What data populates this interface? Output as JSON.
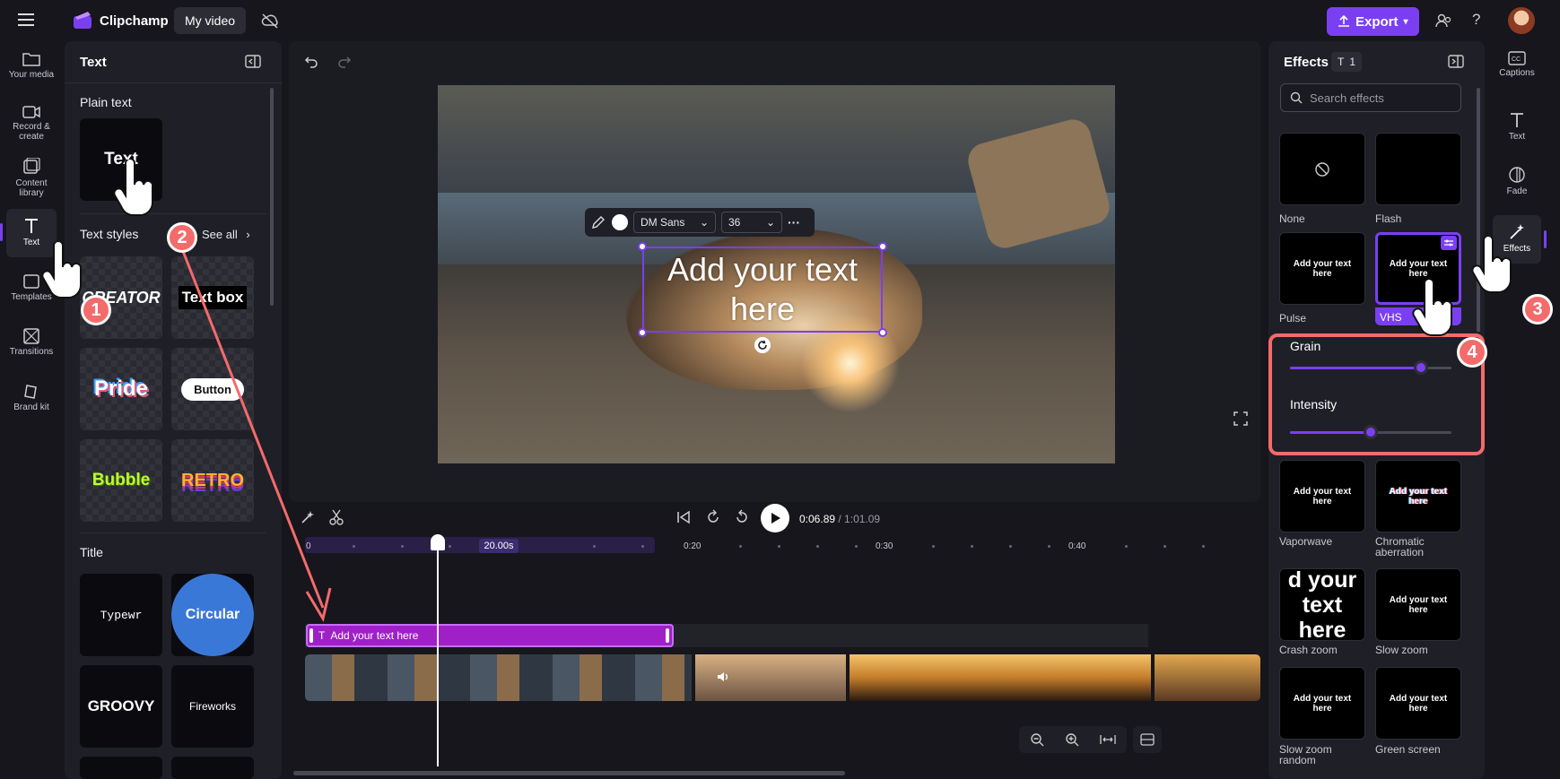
{
  "app": {
    "name": "Clipchamp",
    "project_name": "My video",
    "export_label": "Export"
  },
  "leftnav": [
    {
      "label": "Your media",
      "icon": "folder-icon"
    },
    {
      "label": "Record & create",
      "icon": "camera-icon"
    },
    {
      "label": "Content library",
      "icon": "library-icon"
    },
    {
      "label": "Text",
      "icon": "text-icon"
    },
    {
      "label": "Templates",
      "icon": "templates-icon"
    },
    {
      "label": "Transitions",
      "icon": "transitions-icon"
    },
    {
      "label": "Brand kit",
      "icon": "brand-kit-icon"
    }
  ],
  "textpanel": {
    "title": "Text",
    "plain_text_heading": "Plain text",
    "plain_text_tile": "Text",
    "styles_heading": "Text styles",
    "see_all": "See all",
    "styles": [
      "CREATOR",
      "Text box",
      "Pride",
      "Button",
      "Bubble",
      "RETRO"
    ],
    "title_heading": "Title",
    "titles": [
      "Typewr",
      "Circular",
      "GROOVY",
      "Fireworks"
    ]
  },
  "preview": {
    "font": "DM Sans",
    "font_size": "36",
    "overlay_text": "Add your text here"
  },
  "playback": {
    "current": "0:06.89",
    "total": "/ 1:01.09"
  },
  "timeline": {
    "ticks": [
      "0",
      "0:20",
      "0:30",
      "0:40"
    ],
    "duration_badge": "20.00s",
    "text_clip_label": "Add your text here"
  },
  "effects": {
    "title": "Effects",
    "count": "1",
    "search_placeholder": "Search effects",
    "tile_text": "Add your text here",
    "tiles": [
      {
        "label": "None"
      },
      {
        "label": "Flash"
      },
      {
        "label": "Pulse"
      },
      {
        "label": "VHS"
      },
      {
        "label": "Vaporwave"
      },
      {
        "label": "Chromatic aberration"
      },
      {
        "label": "Crash zoom"
      },
      {
        "label": "Slow zoom"
      },
      {
        "label": "Slow zoom random"
      },
      {
        "label": "Green screen"
      }
    ],
    "crash_zoom_text": "d your text here",
    "sliders": [
      {
        "label": "Grain",
        "value": 0.81
      },
      {
        "label": "Intensity",
        "value": 0.5
      }
    ]
  },
  "rightnav": [
    {
      "label": "Captions",
      "icon": "captions-icon"
    },
    {
      "label": "Text",
      "icon": "text-icon"
    },
    {
      "label": "Fade",
      "icon": "fade-icon"
    },
    {
      "label": "Effects",
      "icon": "effects-wand-icon"
    }
  ],
  "steps": [
    "1",
    "2",
    "3",
    "4"
  ],
  "colors": {
    "accent": "#7b3ff2",
    "highlight": "#f36b6b",
    "clip": "#a020c8"
  }
}
